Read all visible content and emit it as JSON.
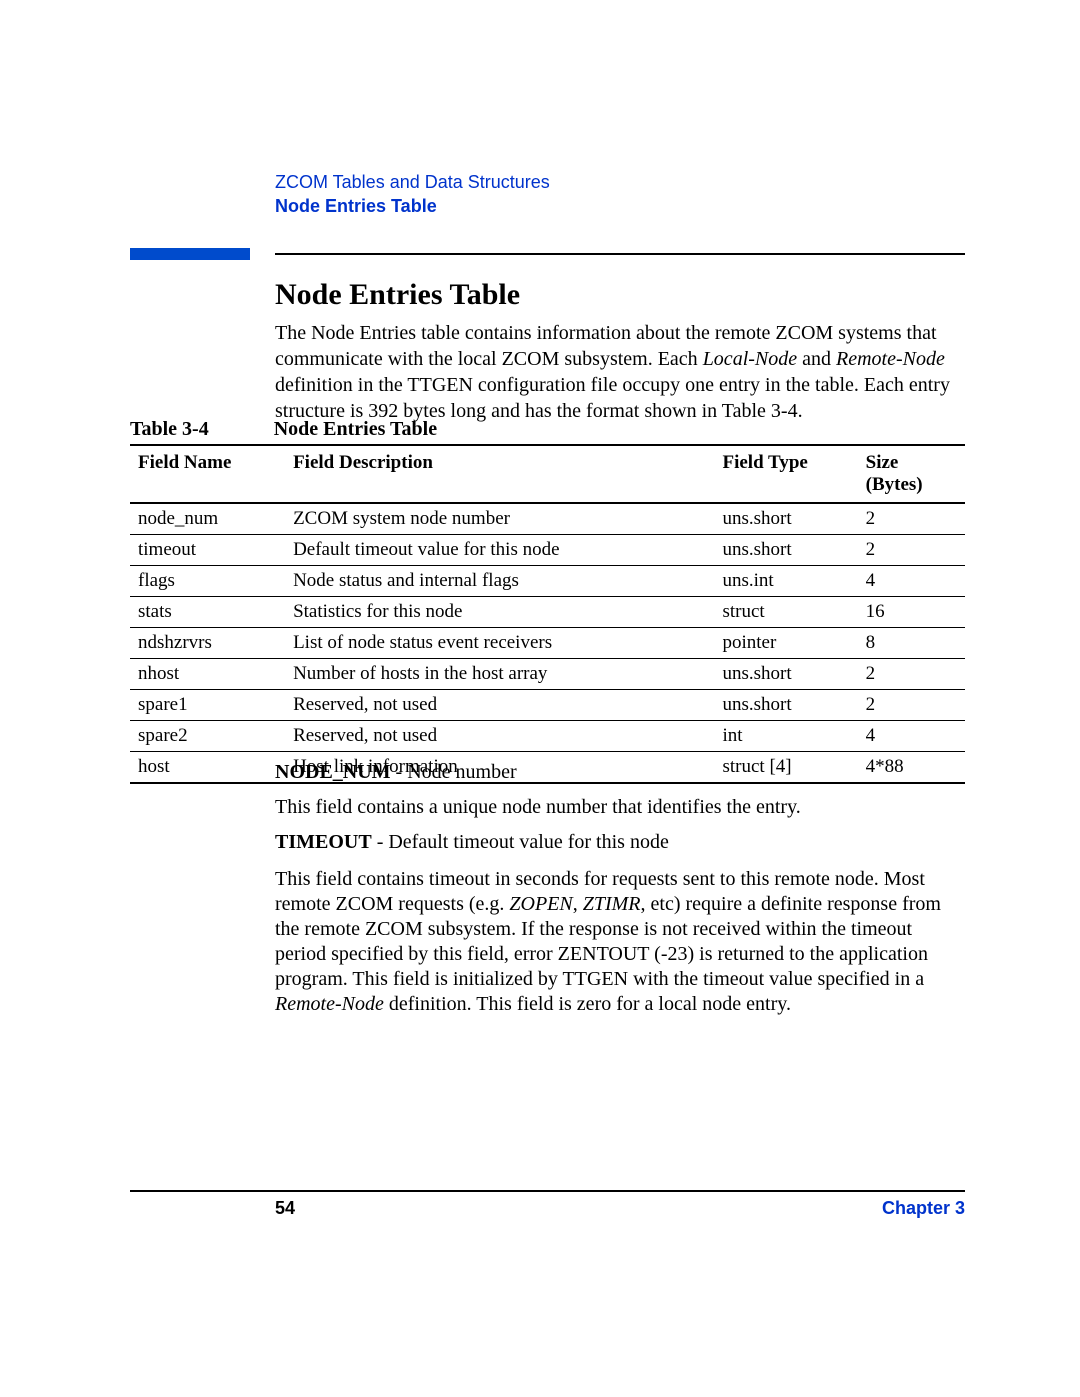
{
  "header": {
    "breadcrumb": "ZCOM Tables and Data Structures",
    "section": "Node Entries Table"
  },
  "title": "Node Entries Table",
  "intro": {
    "pre": "The Node Entries table contains information about the remote ZCOM systems that communicate with the local ZCOM subsystem. Each ",
    "i1": "Local-Node",
    "mid1": " and ",
    "i2": "Remote-Node",
    "post": " definition in the TTGEN configuration file occupy one entry in the table. Each entry structure is 392 bytes long and has the format shown in Table 3-4."
  },
  "table_label": "Table 3-4",
  "table_caption": "Node Entries Table",
  "columns": {
    "c0": "Field Name",
    "c1": "Field Description",
    "c2": "Field Type",
    "c3": "Size (Bytes)"
  },
  "rows": [
    {
      "name": "node_num",
      "desc": "ZCOM system node number",
      "type": "uns.short",
      "size": "2"
    },
    {
      "name": "timeout",
      "desc": "Default timeout value for this node",
      "type": "uns.short",
      "size": "2"
    },
    {
      "name": "flags",
      "desc": "Node status and internal flags",
      "type": "uns.int",
      "size": "4"
    },
    {
      "name": "stats",
      "desc": "Statistics for this node",
      "type": "struct",
      "size": "16"
    },
    {
      "name": "ndshzrvrs",
      "desc": "List of node status event receivers",
      "type": "pointer",
      "size": "8"
    },
    {
      "name": "nhost",
      "desc": "Number of hosts in the host array",
      "type": "uns.short",
      "size": "2"
    },
    {
      "name": "spare1",
      "desc": "Reserved, not used",
      "type": "uns.short",
      "size": "2"
    },
    {
      "name": "spare2",
      "desc": "Reserved, not used",
      "type": "int",
      "size": "4"
    },
    {
      "name": "host",
      "desc": "Host link information",
      "type": "struct [4]",
      "size": "4*88"
    }
  ],
  "field_defs": {
    "node_num": {
      "label": "NODE_NUM",
      "dash": " - Node number",
      "body": "This field contains a unique node number that identifies the entry."
    },
    "timeout": {
      "label": "TIMEOUT",
      "dash": " - Default timeout value for this node",
      "body_pre": "This field contains timeout in seconds for requests sent to this remote node. Most remote ZCOM requests (e.g. ",
      "i1": "ZOPEN",
      "mid1": ", ",
      "i2": "ZTIMR",
      "mid2": ", etc) require a definite response from the remote ZCOM subsystem. If the response is not received within the timeout period specified by this field, error ZENTOUT (-23) is returned to the application program. This field is initialized by TTGEN with the timeout value specified in a ",
      "i3": "Remote-Node",
      "post": " definition. This field is zero for a local node entry."
    }
  },
  "footer": {
    "page": "54",
    "chapter": "Chapter 3"
  }
}
